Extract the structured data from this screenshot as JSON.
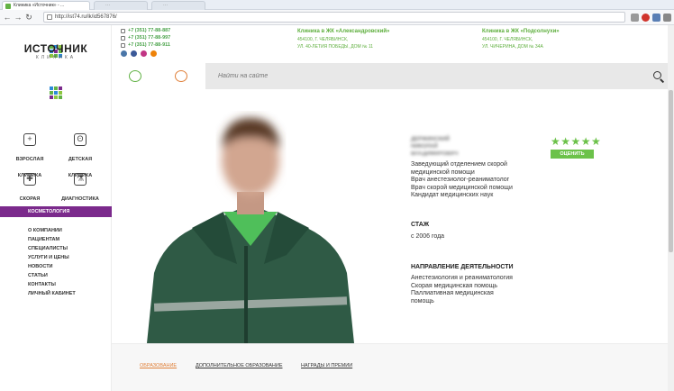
{
  "browser": {
    "tab_active": "Клиника «Источник» - ...",
    "tab_bg1": "···",
    "tab_bg2": "···",
    "url": "http://ist74.ru/lk/id567876/"
  },
  "sidebar": {
    "brand": "ИСТОЧНИК",
    "brand_sub": "КЛИНИКА",
    "services": [
      {
        "label": "ВЗРОСЛАЯ КЛИНИКА",
        "icon": "adult-clinic-icon"
      },
      {
        "label": "ДЕТСКАЯ КЛИНИКА",
        "icon": "teddy-bear-icon"
      },
      {
        "label": "СКОРАЯ ПОМОЩЬ",
        "icon": "ambulance-icon"
      },
      {
        "label": "ДИАГНОСТИКА",
        "icon": "flask-icon"
      }
    ],
    "highlight": "КОСМЕТОЛОГИЯ",
    "menu": [
      "О КОМПАНИИ",
      "ПАЦИЕНТАМ",
      "СПЕЦИАЛИСТЫ",
      "УСЛУГИ И ЦЕНЫ",
      "НОВОСТИ",
      "СТАТЬИ",
      "КОНТАКТЫ",
      "ЛИЧНЫЙ КАБИНЕТ"
    ]
  },
  "header": {
    "phones": [
      "+7 (351) 77-88-887",
      "+7 (351) 77-88-997",
      "+7 (351) 77-88-911"
    ],
    "clinic1": {
      "title": "Клиника в ЖК «Александровский»",
      "addr1": "454100, Г. ЧЕЛЯБИНСК,",
      "addr2": "УЛ. 40-ЛЕТИЯ ПОБЕДЫ, ДОМ № 11"
    },
    "clinic2": {
      "title": "Клиника в ЖК «Подсолнухи»",
      "addr1": "454100, Г. ЧЕЛЯБИНСК,",
      "addr2": "УЛ. ЧИЧЕРИНА, ДОМ № 34А"
    },
    "search_placeholder": "Найти на сайте"
  },
  "doctor": {
    "name1": "ДЕРЖИНСКИЙ",
    "name2": "НИКОЛАЙ",
    "name3": "ВЛАДИМИРОВИЧ",
    "roles": [
      "Заведующий отделением скорой",
      "медицинской помощи",
      "Врач анестезиолог-реаниматолог",
      "Врач скорой медицинской помощи",
      "Кандидат медицинских наук"
    ],
    "stazh_title": "СТАЖ",
    "stazh_value": "с 2006 года",
    "direction_title": "НАПРАВЛЕНИЕ ДЕЯТЕЛЬНОСТИ",
    "directions": [
      "Анестезиология  и реаниматология",
      "Скорая медицинская помощь",
      "Паллиативная медицинская",
      "помощь"
    ],
    "rating_stars": "★★★★★",
    "rate_button": "ОЦЕНИТЬ"
  },
  "bottom_tabs": [
    "ОБРАЗОВАНИЕ",
    "ДОПОЛНИТЕЛЬНОЕ ОБРАЗОВАНИЕ",
    "НАГРАДЫ И ПРЕМИИ"
  ],
  "colors": {
    "accent_green": "#62b246",
    "purple": "#7b2a8c",
    "orange": "#e0803a"
  }
}
